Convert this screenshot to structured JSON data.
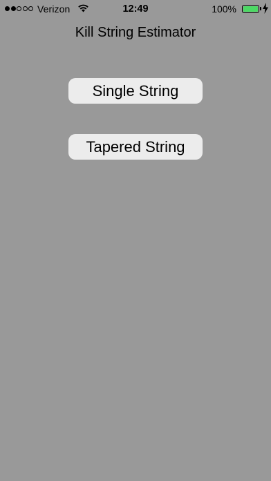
{
  "status_bar": {
    "signal": {
      "filled_dots": 2,
      "total_dots": 5
    },
    "carrier": "Verizon",
    "wifi_icon": "wifi-icon",
    "time": "12:49",
    "battery_percent": "100%",
    "battery_level": 1.0,
    "battery_color": "#4cd964",
    "charging_icon": "bolt-icon"
  },
  "header": {
    "title": "Kill String Estimator"
  },
  "main": {
    "buttons": [
      {
        "label": "Single String"
      },
      {
        "label": "Tapered String"
      }
    ]
  },
  "colors": {
    "background": "#999999",
    "button_background": "#ececec"
  }
}
